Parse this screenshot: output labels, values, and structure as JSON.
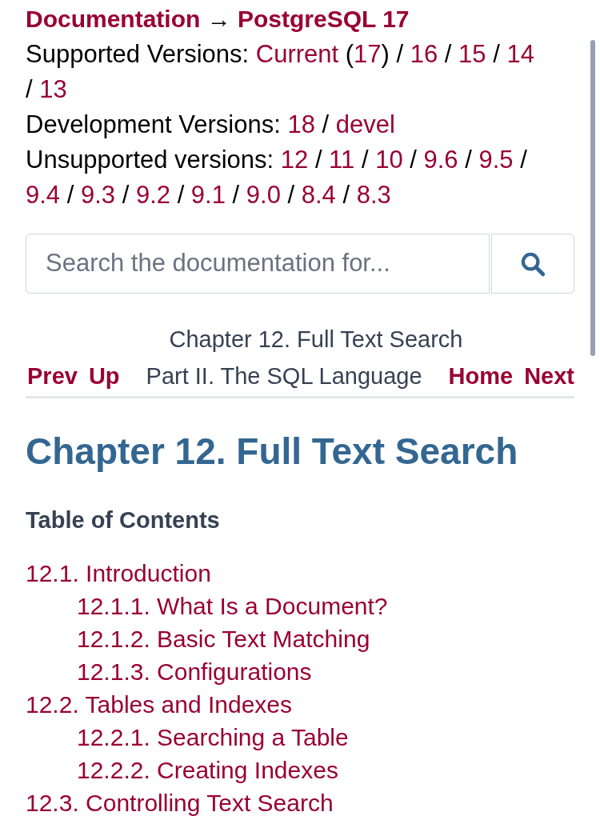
{
  "breadcrumb": [
    {
      "text": "Documentation",
      "link": true
    },
    {
      "text": "→",
      "link": false
    },
    {
      "text": "PostgreSQL 17",
      "link": true
    }
  ],
  "version_lines": [
    {
      "segments": [
        {
          "text": "Supported Versions: ",
          "link": false
        },
        {
          "text": "Current",
          "link": true
        },
        {
          "text": " (",
          "link": false
        },
        {
          "text": "17",
          "link": true
        },
        {
          "text": ") / ",
          "link": false
        },
        {
          "text": "16",
          "link": true
        },
        {
          "text": " / ",
          "link": false
        },
        {
          "text": "15",
          "link": true
        },
        {
          "text": " / ",
          "link": false
        },
        {
          "text": "14",
          "link": true
        },
        {
          "text": " / ",
          "link": false
        },
        {
          "text": "13",
          "link": true
        }
      ]
    },
    {
      "segments": [
        {
          "text": "Development Versions: ",
          "link": false
        },
        {
          "text": "18",
          "link": true
        },
        {
          "text": " / ",
          "link": false
        },
        {
          "text": "devel",
          "link": true
        }
      ]
    },
    {
      "segments": [
        {
          "text": "Unsupported versions: ",
          "link": false
        },
        {
          "text": "12",
          "link": true
        },
        {
          "text": " / ",
          "link": false
        },
        {
          "text": "11",
          "link": true
        },
        {
          "text": " / ",
          "link": false
        },
        {
          "text": "10",
          "link": true
        },
        {
          "text": " / ",
          "link": false
        },
        {
          "text": "9.6",
          "link": true
        },
        {
          "text": " / ",
          "link": false
        },
        {
          "text": "9.5",
          "link": true
        },
        {
          "text": " / ",
          "link": false
        },
        {
          "text": "9.4",
          "link": true
        },
        {
          "text": " / ",
          "link": false
        },
        {
          "text": "9.3",
          "link": true
        },
        {
          "text": " / ",
          "link": false
        },
        {
          "text": "9.2",
          "link": true
        },
        {
          "text": " / ",
          "link": false
        },
        {
          "text": "9.1",
          "link": true
        },
        {
          "text": " / ",
          "link": false
        },
        {
          "text": "9.0",
          "link": true
        },
        {
          "text": " / ",
          "link": false
        },
        {
          "text": "8.4",
          "link": true
        },
        {
          "text": " / ",
          "link": false
        },
        {
          "text": "8.3",
          "link": true
        }
      ]
    }
  ],
  "search": {
    "placeholder": "Search the documentation for..."
  },
  "nav_header": {
    "title": "Chapter 12. Full Text Search",
    "prev": "Prev",
    "up": "Up",
    "part": "Part II. The SQL Language",
    "home": "Home",
    "next": "Next"
  },
  "heading": "Chapter 12. Full Text Search",
  "toc_title": "Table of Contents",
  "toc": [
    {
      "text": "12.1. Introduction",
      "children": [
        {
          "text": "12.1.1. What Is a Document?"
        },
        {
          "text": "12.1.2. Basic Text Matching"
        },
        {
          "text": "12.1.3. Configurations"
        }
      ]
    },
    {
      "text": "12.2. Tables and Indexes",
      "children": [
        {
          "text": "12.2.1. Searching a Table"
        },
        {
          "text": "12.2.2. Creating Indexes"
        }
      ]
    },
    {
      "text": "12.3. Controlling Text Search"
    }
  ]
}
